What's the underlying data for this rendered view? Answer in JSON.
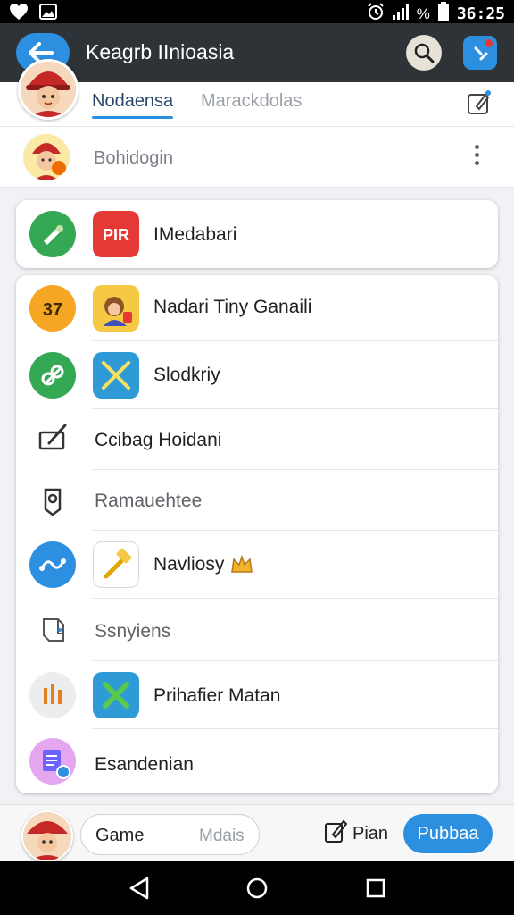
{
  "status_bar": {
    "time": "36:25",
    "battery_text": "%"
  },
  "app_bar": {
    "title": "Keagrb IInioasia"
  },
  "tabs": {
    "active": "Nodaensa",
    "inactive": "Marackdolas"
  },
  "second_row": {
    "label": "Bohidogin"
  },
  "card1": {
    "label": "IMedabari",
    "tile_text": "PIR"
  },
  "list": [
    {
      "label": "Nadari Tiny Ganaili",
      "lead_text": "37"
    },
    {
      "label": "Slodkriy"
    },
    {
      "label": "Ccibag Hoidani"
    },
    {
      "label": "Ramauehtee"
    },
    {
      "label": "Navliosy"
    },
    {
      "label": "Ssnyiens"
    },
    {
      "label": "Prihafier Matan"
    },
    {
      "label": "Esandenian"
    }
  ],
  "bottom_bar": {
    "segment_a": "Game",
    "segment_b": "Mdais",
    "plan_label": "Pian",
    "primary_label": "Pubbaa"
  },
  "colors": {
    "accent": "#2c8fe0",
    "app_bar": "#2e3338"
  }
}
